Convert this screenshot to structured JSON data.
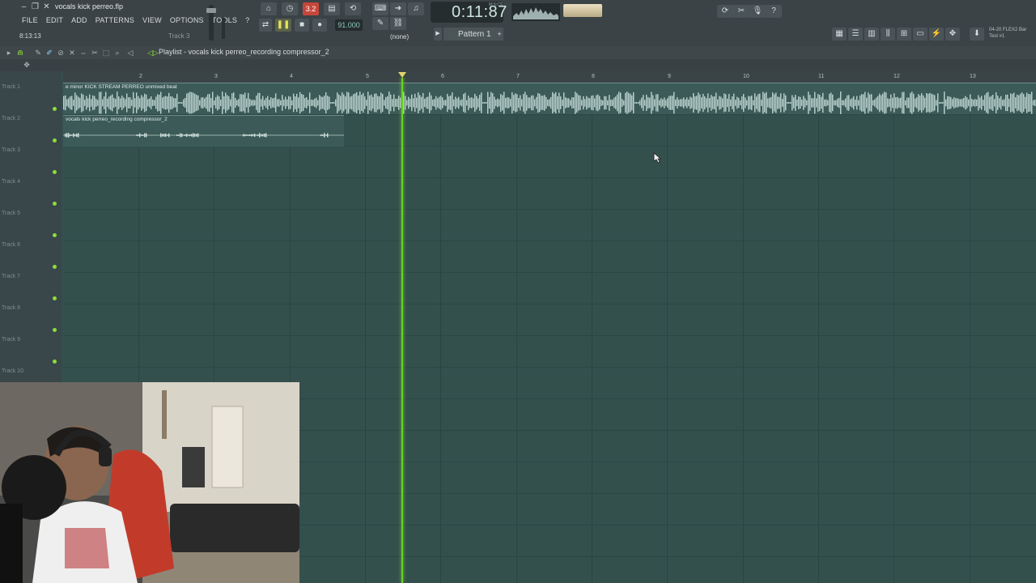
{
  "window": {
    "filename": "vocals kick perreo.flp"
  },
  "menu": [
    "FILE",
    "EDIT",
    "ADD",
    "PATTERNS",
    "VIEW",
    "OPTIONS",
    "TOOLS",
    "?"
  ],
  "hint": {
    "value": "8:13:13",
    "track": "Track 3"
  },
  "transport": {
    "mode": "3.2",
    "tempo": "91.000",
    "time": "0:11:87",
    "time_unit": "M:S:CS",
    "pattern_selector": "(none)",
    "pattern": "Pattern 1"
  },
  "top_right": {
    "label_line1": "04-20 FLEX2 Bar",
    "label_line2": "Test #1"
  },
  "playlist": {
    "title": "Playlist - vocals kick perreo_recording compressor_2",
    "bar_numbers": [
      "2",
      "3",
      "4",
      "5",
      "6",
      "7",
      "8",
      "9",
      "10",
      "11",
      "12",
      "13"
    ],
    "tracks": [
      "Track 1",
      "Track 2",
      "Track 3",
      "Track 4",
      "Track 5",
      "Track 6",
      "Track 7",
      "Track 8",
      "Track 9",
      "Track 10"
    ],
    "clips": [
      {
        "name": "e minor KICK STREAM PERREO unmixed beat",
        "track": 1
      },
      {
        "name": "vocals kick perreo_recording compressor_2",
        "track": 2
      }
    ],
    "colors": {
      "background": "#33504d",
      "playhead": "#6bd02a",
      "clip_wave": "#bcd3cf"
    }
  }
}
